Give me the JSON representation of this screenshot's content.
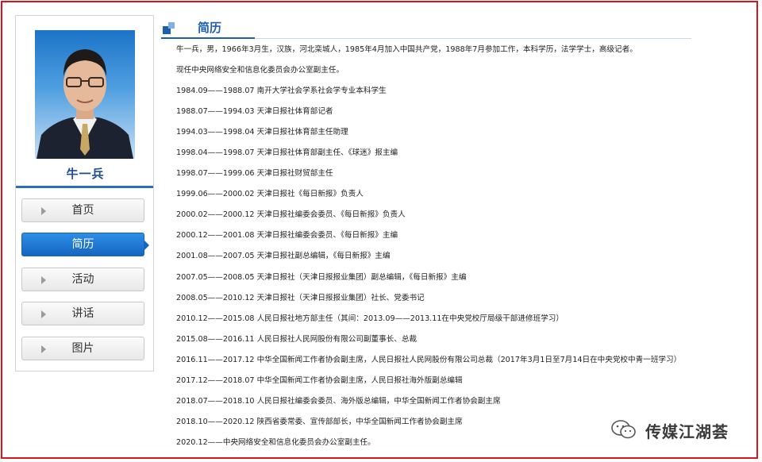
{
  "profile": {
    "name": "牛一兵"
  },
  "nav": {
    "items": [
      {
        "label": "首页",
        "active": false
      },
      {
        "label": "简历",
        "active": true
      },
      {
        "label": "活动",
        "active": false
      },
      {
        "label": "讲话",
        "active": false
      },
      {
        "label": "图片",
        "active": false
      }
    ]
  },
  "section": {
    "title": "简历"
  },
  "bio": {
    "lines": [
      "牛一兵，男，1966年3月生，汉族，河北栾城人，1985年4月加入中国共产党，1988年7月参加工作，本科学历，法学学士，高级记者。",
      "现任中央网络安全和信息化委员会办公室副主任。",
      "1984.09——1988.07 南开大学社会学系社会学专业本科学生",
      "1988.07——1994.03 天津日报社体育部记者",
      "1994.03——1998.04 天津日报社体育部主任助理",
      "1998.04——1998.07 天津日报社体育部副主任、《球迷》报主编",
      "1998.07——1999.06 天津日报社财贸部主任",
      "1999.06——2000.02 天津日报社《每日新报》负责人",
      "2000.02——2000.12 天津日报社编委会委员、《每日新报》负责人",
      "2000.12——2001.08 天津日报社编委会委员、《每日新报》主编",
      "2001.08——2007.05 天津日报社副总编辑，《每日新报》主编",
      "2007.05——2008.05 天津日报社（天津日报报业集团）副总编辑，《每日新报》主编",
      "2008.05——2010.12 天津日报社（天津日报报业集团）社长、党委书记",
      "2010.12——2015.08 人民日报社地方部主任（其间：2013.09——2013.11在中央党校厅局级干部进修班学习）",
      "2015.08——2016.11 人民日报社人民网股份有限公司副董事长、总裁",
      "2016.11——2017.12 中华全国新闻工作者协会副主席，人民日报社人民网股份有限公司总裁（2017年3月1日至7月14日在中央党校中青一班学习）",
      "2017.12——2018.07 中华全国新闻工作者协会副主席，人民日报社海外版副总编辑",
      "2018.07——2018.10 人民日报社编委会委员、海外版总编辑，中华全国新闻工作者协会副主席",
      "2018.10——2020.12 陕西省委常委、宣传部部长，中华全国新闻工作者协会副主席",
      "2020.12——中央网络安全和信息化委员会办公室副主任。"
    ]
  },
  "watermark": {
    "text": "传媒江湖荟",
    "icon": "wechat-icon"
  },
  "colors": {
    "accent": "#1b5fb0",
    "frame": "#d9161e",
    "active_nav": "#1565c0"
  }
}
